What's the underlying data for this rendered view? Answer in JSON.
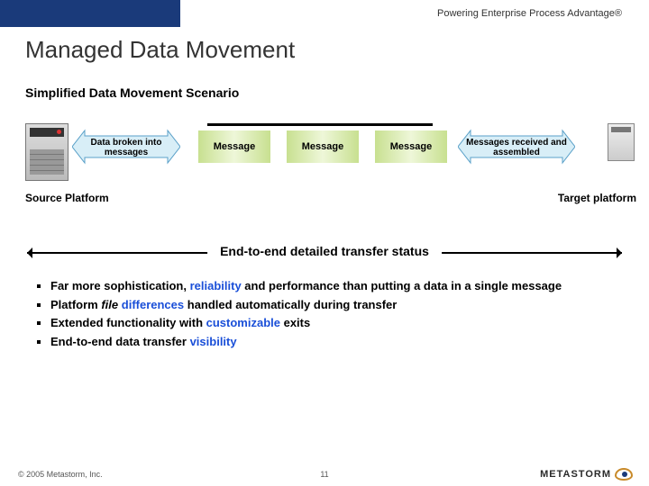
{
  "tagline": "Powering Enterprise Process Advantage®",
  "title": "Managed Data Movement",
  "subtitle": "Simplified Data Movement Scenario",
  "diagram": {
    "breakLabel": "Data broken into messages",
    "msg1": "Message",
    "msg2": "Message",
    "msg3": "Message",
    "assembleLabel": "Messages received and assembled",
    "sourceLabel": "Source Platform",
    "targetLabel": "Target platform"
  },
  "statusBar": "End-to-end detailed transfer status",
  "bullets": {
    "b1a": "Far more sophistication, ",
    "b1b": "reliability",
    "b1c": " and performance than putting a data in a single message",
    "b2a": "Platform ",
    "b2b": "file",
    "b2c": " ",
    "b2d": "differences",
    "b2e": " handled automatically during transfer",
    "b3a": "Extended functionality with ",
    "b3b": "customizable",
    "b3c": " exits",
    "b4a": "End-to-end data transfer ",
    "b4b": "visibility"
  },
  "footer": "© 2005 Metastorm, Inc.",
  "pageNumber": "11",
  "brand": "METASTORM"
}
